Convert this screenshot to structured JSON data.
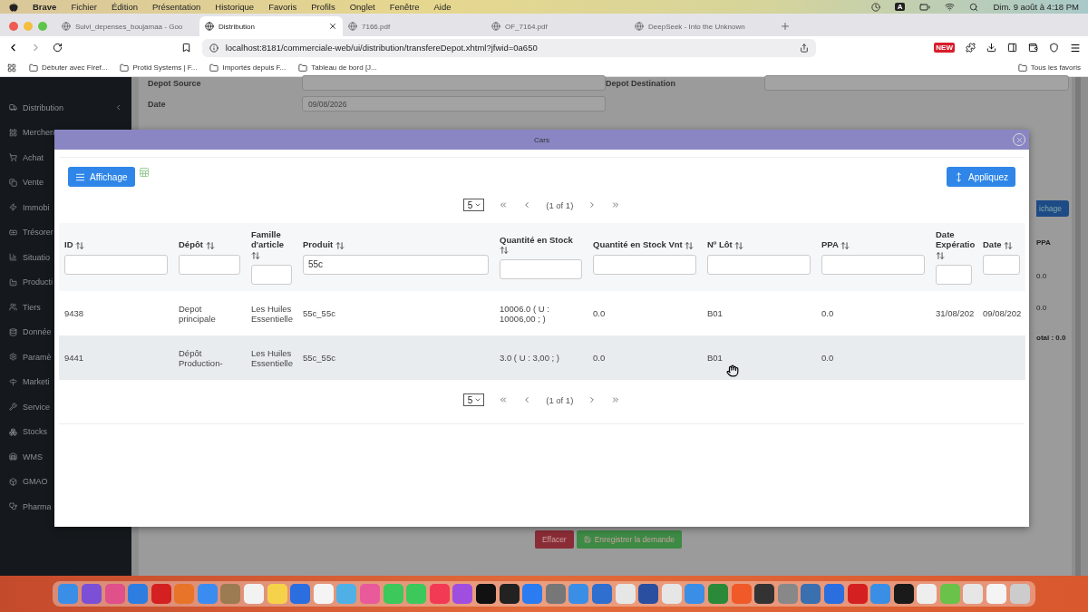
{
  "menubar": {
    "app": "Brave",
    "items": [
      "Fichier",
      "Édition",
      "Présentation",
      "Historique",
      "Favoris",
      "Profils",
      "Onglet",
      "Fenêtre",
      "Aide"
    ],
    "status_letter": "A",
    "clock": "Dim. 9 août à 4:18 PM"
  },
  "tabs": [
    {
      "title": "Suivi_depenses_boujamaa - Goo",
      "selected": false
    },
    {
      "title": "Distribution",
      "selected": true
    },
    {
      "title": "7166.pdf",
      "selected": false
    },
    {
      "title": "OF_7164.pdf",
      "selected": false
    },
    {
      "title": "DeepSeek - Into the Unknown",
      "selected": false
    }
  ],
  "address": "localhost:8181/commerciale-web/ui/distribution/transfereDepot.xhtml?jfwid=0a650",
  "extension_badge": "NEW",
  "bookmarks": [
    "Débuter avec Firef...",
    "Protid Systems | F...",
    "Importés depuis F...",
    "Tableau de bord [J..."
  ],
  "all_bookmarks": "Tous les favoris",
  "sidebar": {
    "items": [
      {
        "label": "Distribution",
        "submenu": true
      },
      {
        "label": "Merchen"
      },
      {
        "label": "Achat"
      },
      {
        "label": "Vente"
      },
      {
        "label": "Immobi"
      },
      {
        "label": "Trésorer"
      },
      {
        "label": "Situatio"
      },
      {
        "label": "Producti"
      },
      {
        "label": "Tiers"
      },
      {
        "label": "Donnée"
      },
      {
        "label": "Paramè"
      },
      {
        "label": "Marketi"
      },
      {
        "label": "Service"
      },
      {
        "label": "Stocks"
      },
      {
        "label": "WMS"
      },
      {
        "label": "GMAO"
      },
      {
        "label": "Pharma"
      }
    ]
  },
  "form": {
    "source_label": "Depot Source",
    "date_label": "Date",
    "date_value": "09/08/2026",
    "destination_label": "Depot Destination"
  },
  "background": {
    "display_button": "ichage",
    "column": "PPA",
    "values": [
      "0.0",
      "0.0"
    ],
    "total": "otal : 0.0",
    "clear_button": "Effacer",
    "save_button": "Enregistrer la demande"
  },
  "dialog": {
    "title": "Cars",
    "display_button": "Affichage",
    "apply_button": "Appliquez",
    "paginator": {
      "rows_per_page": "5",
      "report": "(1 of 1)"
    },
    "columns": [
      {
        "label": "ID"
      },
      {
        "label": "Dépôt"
      },
      {
        "label": "Famille d'article"
      },
      {
        "label": "Produit",
        "filter": "55c"
      },
      {
        "label": "Quantité en Stock"
      },
      {
        "label": "Quantité en Stock Vnt"
      },
      {
        "label": "Nº Lôt"
      },
      {
        "label": "PPA"
      },
      {
        "label": "Date Expératio"
      },
      {
        "label": "Date"
      }
    ],
    "rows": [
      {
        "hovered": false,
        "cells": [
          "9438",
          "Depot principale",
          "Les Huiles Essentielle",
          "55c_55c",
          "10006.0 ( U : 10006,00 ; )",
          "0.0",
          "B01",
          "0.0",
          "31/08/202",
          "09/08/202"
        ]
      },
      {
        "hovered": true,
        "cells": [
          "9441",
          "Dépôt Production-",
          "Les Huiles Essentielle",
          "55c_55c",
          "3.0 ( U : 3,00 ; )",
          "0.0",
          "B01",
          "0.0",
          "",
          ""
        ]
      }
    ],
    "bottom_paginator": {
      "rows_per_page": "5",
      "report": "(1 of 1)"
    }
  }
}
